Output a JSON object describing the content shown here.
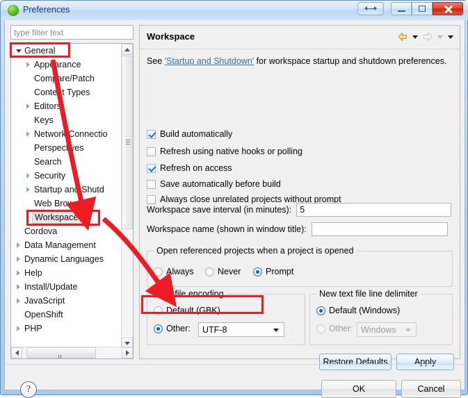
{
  "window": {
    "title": "Preferences",
    "icon": "eclipse-sphere-icon",
    "controls": {
      "resize": "resize-button",
      "minimize": "minimize-button",
      "maximize": "maximize-button",
      "close": "close-button"
    }
  },
  "sidebar": {
    "filter": {
      "placeholder": "type filter text",
      "value": ""
    },
    "items": [
      {
        "label": "General",
        "indent": 0,
        "twisty": "expanded",
        "selected": false
      },
      {
        "label": "Appearance",
        "indent": 1,
        "twisty": "collapsed",
        "selected": false
      },
      {
        "label": "Compare/Patch",
        "indent": 1,
        "twisty": "none",
        "selected": false
      },
      {
        "label": "Content Types",
        "indent": 1,
        "twisty": "none",
        "selected": false
      },
      {
        "label": "Editors",
        "indent": 1,
        "twisty": "collapsed",
        "selected": false
      },
      {
        "label": "Keys",
        "indent": 1,
        "twisty": "none",
        "selected": false
      },
      {
        "label": "Network Connectio",
        "indent": 1,
        "twisty": "collapsed",
        "selected": false
      },
      {
        "label": "Perspectives",
        "indent": 1,
        "twisty": "none",
        "selected": false
      },
      {
        "label": "Search",
        "indent": 1,
        "twisty": "none",
        "selected": false
      },
      {
        "label": "Security",
        "indent": 1,
        "twisty": "collapsed",
        "selected": false
      },
      {
        "label": "Startup and Shutd",
        "indent": 1,
        "twisty": "collapsed",
        "selected": false
      },
      {
        "label": "Web Browser",
        "indent": 1,
        "twisty": "none",
        "selected": false
      },
      {
        "label": "Workspace",
        "indent": 1,
        "twisty": "collapsed",
        "selected": true
      },
      {
        "label": "Cordova",
        "indent": 0,
        "twisty": "none",
        "selected": false
      },
      {
        "label": "Data Management",
        "indent": 0,
        "twisty": "collapsed",
        "selected": false
      },
      {
        "label": "Dynamic Languages",
        "indent": 0,
        "twisty": "collapsed",
        "selected": false
      },
      {
        "label": "Help",
        "indent": 0,
        "twisty": "collapsed",
        "selected": false
      },
      {
        "label": "Install/Update",
        "indent": 0,
        "twisty": "collapsed",
        "selected": false
      },
      {
        "label": "JavaScript",
        "indent": 0,
        "twisty": "collapsed",
        "selected": false
      },
      {
        "label": "OpenShift",
        "indent": 0,
        "twisty": "none",
        "selected": false
      },
      {
        "label": "PHP",
        "indent": 0,
        "twisty": "collapsed",
        "selected": false
      }
    ]
  },
  "page": {
    "title": "Workspace",
    "nav": {
      "back": "back-arrow-icon",
      "back_menu": "back-dropdown-icon",
      "forward": "forward-arrow-icon",
      "forward_menu": "forward-dropdown-icon",
      "view_menu": "view-menu-icon"
    },
    "see_prefix": "See ",
    "see_link": "'Startup and Shutdown'",
    "see_suffix": " for workspace startup and shutdown preferences.",
    "checkboxes": [
      {
        "label": "Build automatically",
        "checked": true
      },
      {
        "label": "Refresh using native hooks or polling",
        "checked": false
      },
      {
        "label": "Refresh on access",
        "checked": true
      },
      {
        "label": "Save automatically before build",
        "checked": false
      },
      {
        "label": "Always close unrelated projects without prompt",
        "checked": false
      }
    ],
    "save_interval": {
      "label": "Workspace save interval (in minutes):",
      "value": "5"
    },
    "workspace_name": {
      "label": "Workspace name (shown in window title):",
      "value": ""
    },
    "open_referenced": {
      "title": "Open referenced projects when a project is opened",
      "options": [
        {
          "label": "Always",
          "selected": false
        },
        {
          "label": "Never",
          "selected": false
        },
        {
          "label": "Prompt",
          "selected": true
        }
      ]
    },
    "text_file_encoding": {
      "title": "Text file encoding",
      "default_label": "Default (GBK)",
      "default_selected": false,
      "other_label": "Other:",
      "other_selected": true,
      "other_value": "UTF-8"
    },
    "line_delimiter": {
      "title": "New text file line delimiter",
      "default_label": "Default (Windows)",
      "default_selected": true,
      "other_label": "Other:",
      "other_selected": false,
      "other_value": "Windows",
      "other_disabled": true
    },
    "buttons": {
      "restore_defaults": "Restore Defaults",
      "apply": "Apply"
    }
  },
  "footer": {
    "help": "?",
    "ok": "OK",
    "cancel": "Cancel"
  },
  "annotations": {
    "color": "#ed1c24",
    "boxes": [
      "general-highlight",
      "workspace-highlight",
      "encoding-other-highlight"
    ],
    "arrows": [
      "arrow-general-to-workspace",
      "arrow-workspace-to-encoding"
    ]
  }
}
